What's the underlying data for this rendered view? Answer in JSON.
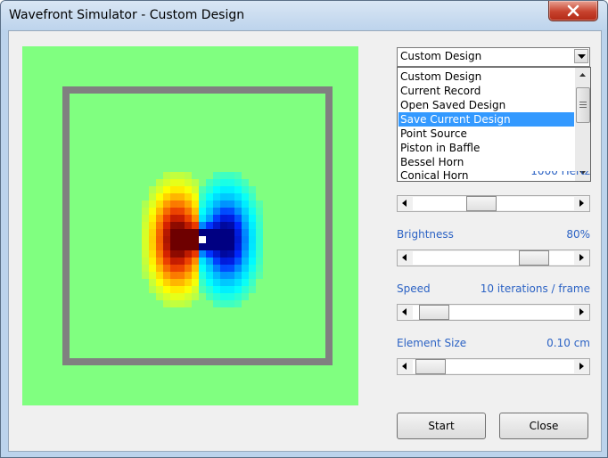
{
  "window": {
    "title": "Wavefront Simulator - Custom Design"
  },
  "design_select": {
    "value": "Custom Design",
    "options": [
      "Custom Design",
      "Current Record",
      "Open Saved Design",
      "Save Current Design",
      "Point Source",
      "Piston in Baffle",
      "Bessel Horn",
      "Conical Horn"
    ],
    "highlighted": "Save Current Design"
  },
  "controls": {
    "frequency": {
      "value_text": "1000 Hertz",
      "level": 0.4
    },
    "brightness": {
      "label": "Brightness",
      "value_text": "80%",
      "level": 0.8
    },
    "speed": {
      "label": "Speed",
      "value_text": "10 iterations / frame",
      "level": 0.05
    },
    "element_size": {
      "label": "Element Size",
      "value_text": "0.10 cm",
      "level": 0.02
    }
  },
  "buttons": {
    "start": "Start",
    "close": "Close"
  },
  "colors": {
    "medium": "#80ff80",
    "wall": "#808080",
    "selection": "#3399ff",
    "label": "#2b62c4"
  }
}
